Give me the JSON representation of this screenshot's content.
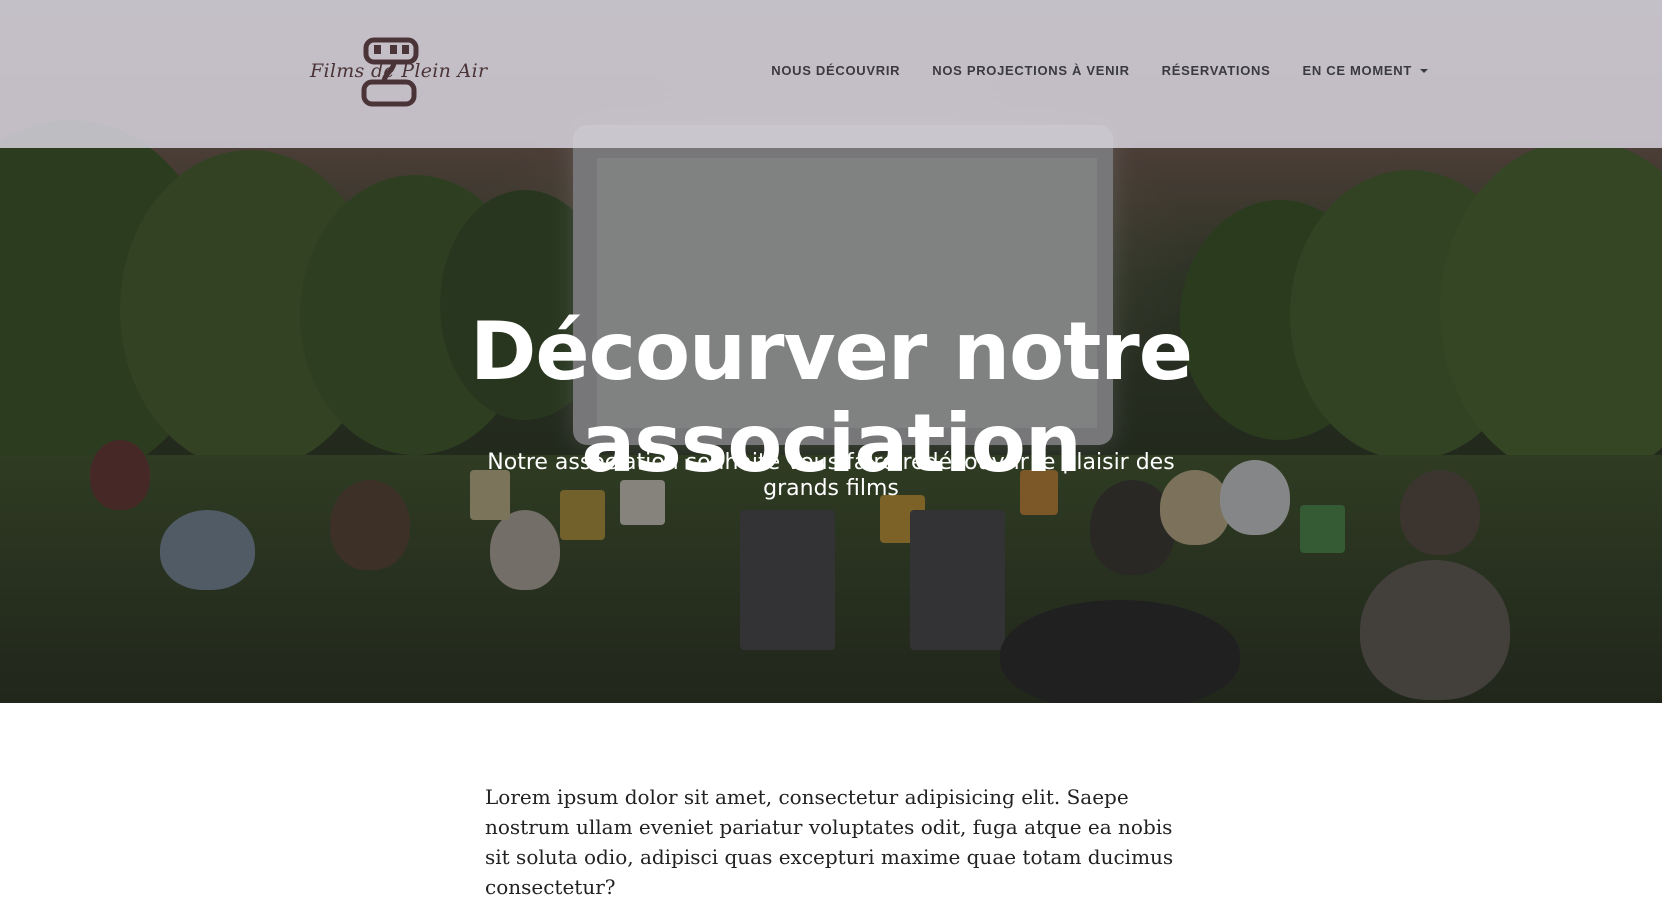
{
  "brand": {
    "logo_text": "Films de Plein Air",
    "logo_color": "#4b3437"
  },
  "nav": {
    "items": [
      {
        "label": "NOUS DÉCOUVRIR"
      },
      {
        "label": "NOS PROJECTIONS À VENIR"
      },
      {
        "label": "RÉSERVATIONS"
      },
      {
        "label": "EN CE MOMENT",
        "dropdown": true
      }
    ]
  },
  "hero": {
    "title": "Décourver notre association",
    "subtitle": "Notre association souhaite vous faire redécouvrir le plaisir des grands films"
  },
  "main": {
    "intro": "Lorem ipsum dolor sit amet, consectetur adipisicing elit. Saepe nostrum ullam eveniet pariatur voluptates odit, fuga atque ea nobis sit soluta odio, adipisci quas excepturi maxime quae totam ducimus consectetur?"
  },
  "icons": {
    "logo": "film-reel-icon",
    "dropdown": "caret-down-icon"
  },
  "colors": {
    "nav_background": "#d6d3dc",
    "nav_text": "#3b3a3e",
    "hero_text": "#ffffff",
    "body_text": "#222222"
  }
}
